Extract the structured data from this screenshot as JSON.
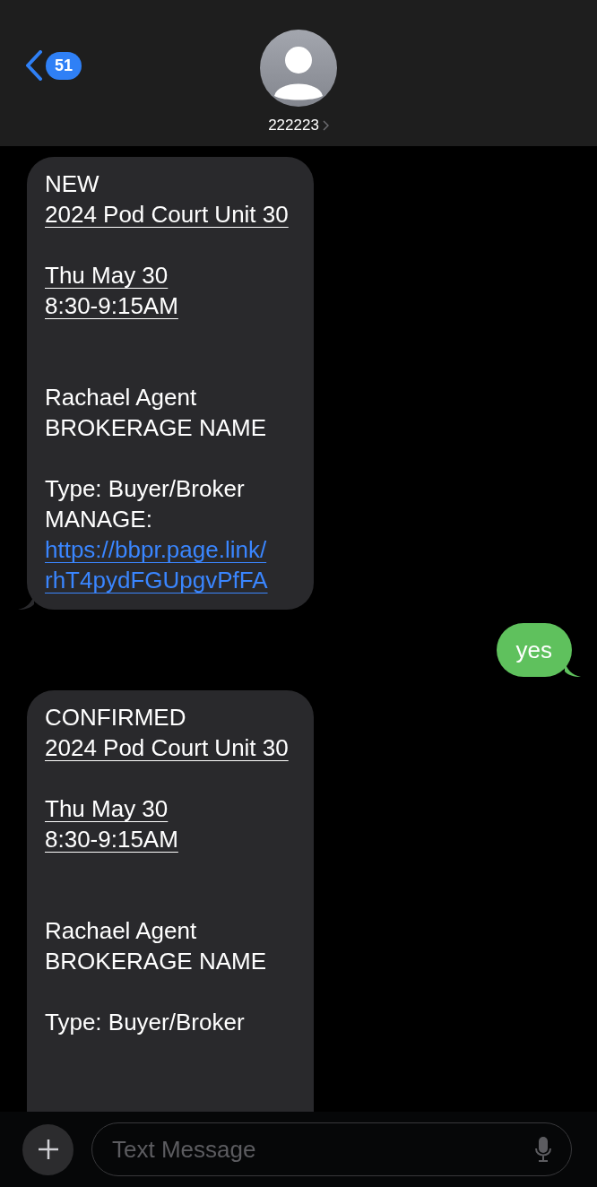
{
  "header": {
    "back_badge": "51",
    "contact": "222223"
  },
  "messages": [
    {
      "kind": "received",
      "lines": [
        {
          "kind": "plain",
          "text": "NEW"
        },
        {
          "kind": "detected",
          "text": "2024 Pod Court Unit 30"
        },
        {
          "kind": "gap"
        },
        {
          "kind": "detected",
          "text": "Thu May 30"
        },
        {
          "kind": "detected",
          "text": "8:30-9:15AM"
        },
        {
          "kind": "gap"
        },
        {
          "kind": "gap"
        },
        {
          "kind": "plain",
          "text": "Rachael Agent"
        },
        {
          "kind": "plain",
          "text": "BROKERAGE NAME"
        },
        {
          "kind": "gap"
        },
        {
          "kind": "plain",
          "text": "Type: Buyer/Broker"
        },
        {
          "kind": "plain",
          "text": "MANAGE:"
        },
        {
          "kind": "link",
          "text": "https://bbpr.page.link/"
        },
        {
          "kind": "link",
          "text": "rhT4pydFGUpgvPfFA"
        }
      ]
    },
    {
      "kind": "sent",
      "lines": [
        {
          "kind": "plain",
          "text": "yes"
        }
      ]
    },
    {
      "kind": "received",
      "lines": [
        {
          "kind": "plain",
          "text": "CONFIRMED"
        },
        {
          "kind": "detected",
          "text": "2024 Pod Court Unit 30"
        },
        {
          "kind": "gap"
        },
        {
          "kind": "detected",
          "text": "Thu May 30"
        },
        {
          "kind": "detected",
          "text": "8:30-9:15AM"
        },
        {
          "kind": "gap"
        },
        {
          "kind": "gap"
        },
        {
          "kind": "plain",
          "text": "Rachael Agent"
        },
        {
          "kind": "plain",
          "text": "BROKERAGE NAME"
        },
        {
          "kind": "gap"
        },
        {
          "kind": "plain",
          "text": "Type: Buyer/Broker"
        },
        {
          "kind": "gap"
        },
        {
          "kind": "gap"
        },
        {
          "kind": "gap"
        },
        {
          "kind": "gap"
        }
      ]
    }
  ],
  "composer": {
    "placeholder": "Text Message"
  }
}
